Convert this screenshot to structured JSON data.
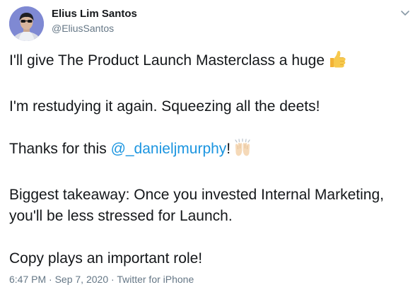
{
  "tweet": {
    "author": {
      "display_name": "Elius Lim Santos",
      "handle": "@EliusSantos",
      "avatar_icon": "profile-photo-icon"
    },
    "menu_icon": "chevron-down-icon",
    "lines": {
      "line1_text": "I'll give The Product Launch Masterclass a huge",
      "line1_emoji": "thumbs-up-emoji",
      "line2_text": "I'm restudying it again. Squeezing all the deets!",
      "line3_prefix": "Thanks for this ",
      "line3_mention": "@_danieljmurphy",
      "line3_suffix": "!",
      "line3_emoji": "raising-hands-emoji",
      "line4_text": "Biggest takeaway: Once you invested Internal Marketing, you'll be less stressed for Launch.",
      "line5_text": "Copy plays an important role!"
    },
    "meta": {
      "time": "6:47 PM",
      "separator1": " · ",
      "date": "Sep 7, 2020",
      "separator2": " · ",
      "source": "Twitter for iPhone"
    }
  },
  "colors": {
    "text": "#14171a",
    "secondary": "#657786",
    "link": "#1b95e0"
  }
}
